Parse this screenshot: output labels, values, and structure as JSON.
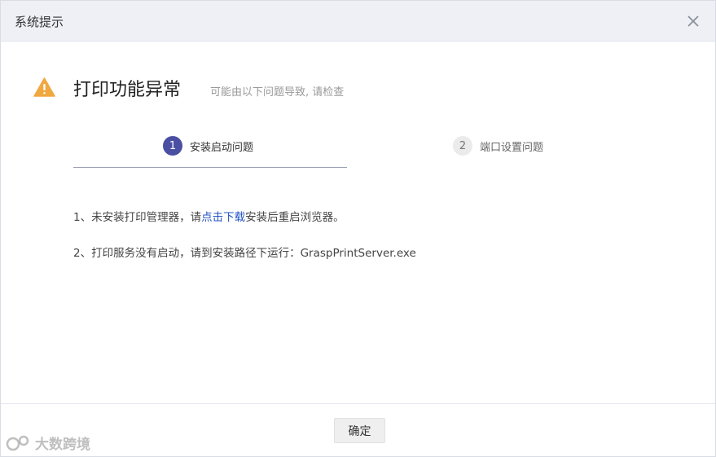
{
  "dialog": {
    "title": "系统提示"
  },
  "error": {
    "title": "打印功能异常",
    "subtitle": "可能由以下问题导致, 请检查"
  },
  "steps": [
    {
      "number": "1",
      "label": "安装启动问题",
      "active": true
    },
    {
      "number": "2",
      "label": "端口设置问题",
      "active": false
    }
  ],
  "content": {
    "line1_prefix": "1、未安装打印管理器，请",
    "line1_link": "点击下载",
    "line1_suffix": "安装后重启浏览器。",
    "line2": "2、打印服务没有启动，请到安装路径下运行：GraspPrintServer.exe"
  },
  "footer": {
    "confirm_label": "确定"
  },
  "watermark": {
    "text": "大数跨境"
  },
  "colors": {
    "accent": "#4a4fa3",
    "warning": "#f0a840",
    "link": "#2454c4",
    "header_bg": "#eef0f6"
  },
  "icons": {
    "warning": "warning-triangle-icon",
    "close": "close-icon"
  }
}
